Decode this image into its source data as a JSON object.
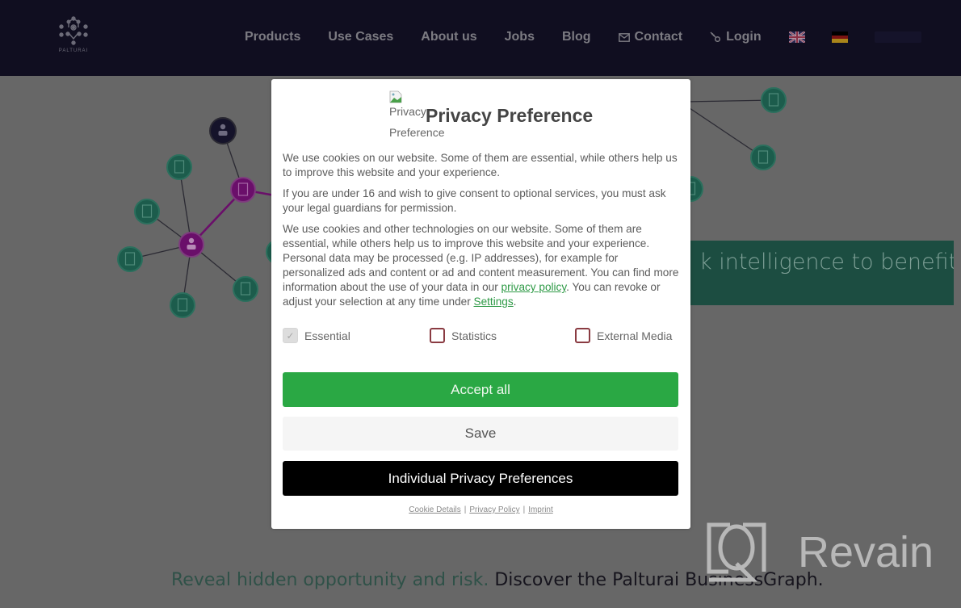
{
  "header": {
    "logo_text": "PALTURAI",
    "nav": [
      {
        "label": "Products"
      },
      {
        "label": "Use Cases"
      },
      {
        "label": "About us"
      },
      {
        "label": "Jobs"
      },
      {
        "label": "Blog"
      },
      {
        "label": "Contact",
        "icon": "envelope-icon"
      },
      {
        "label": "Login",
        "icon": "key-icon"
      }
    ],
    "languages": [
      {
        "code": "en",
        "icon": "uk-flag-icon"
      },
      {
        "code": "de",
        "icon": "german-flag-icon"
      }
    ]
  },
  "hero": {
    "banner_text": "k intelligence to benefit your",
    "tagline_green": "Reveal hidden opportunity and risk.",
    "tagline_dark": " Discover the Palturai BusinessGraph."
  },
  "colors": {
    "header_bg": "#100e20",
    "overlay_bg": "#676767",
    "node_green": "#1c5c4c",
    "node_purple": "#6a0f6a",
    "node_dark": "#15132a",
    "banner_bg": "#1c4d41",
    "accept_green": "#2aa844",
    "checkbox_border": "#8a3b42",
    "link_green": "#2e9a46"
  },
  "modal": {
    "image_alt_line1": "Privacy",
    "image_alt_line2": "Preference",
    "title": "Privacy Preference",
    "paragraph1": "We use cookies on our website. Some of them are essential, while others help us to improve this website and your experience.",
    "paragraph2": "If you are under 16 and wish to give consent to optional services, you must ask your legal guardians for permission.",
    "paragraph3_before": "We use cookies and other technologies on our website. Some of them are essential, while others help us to improve this website and your experience. Personal data may be processed (e.g. IP addresses), for example for personalized ads and content or ad and content measurement. You can find more information about the use of your data in our ",
    "paragraph3_link1": "privacy policy",
    "paragraph3_middle": ". You can revoke or adjust your selection at any time under ",
    "paragraph3_link2": "Settings",
    "paragraph3_end": ".",
    "checkboxes": [
      {
        "label": "Essential",
        "checked": true,
        "disabled": true
      },
      {
        "label": "Statistics",
        "checked": false,
        "disabled": false
      },
      {
        "label": "External Media",
        "checked": false,
        "disabled": false
      }
    ],
    "accept_all": "Accept all",
    "save": "Save",
    "individual": "Individual Privacy Preferences",
    "footer_links": [
      "Cookie Details",
      "Privacy Policy",
      "Imprint"
    ],
    "footer_separator": "|"
  },
  "watermark": {
    "text": "Revain"
  }
}
